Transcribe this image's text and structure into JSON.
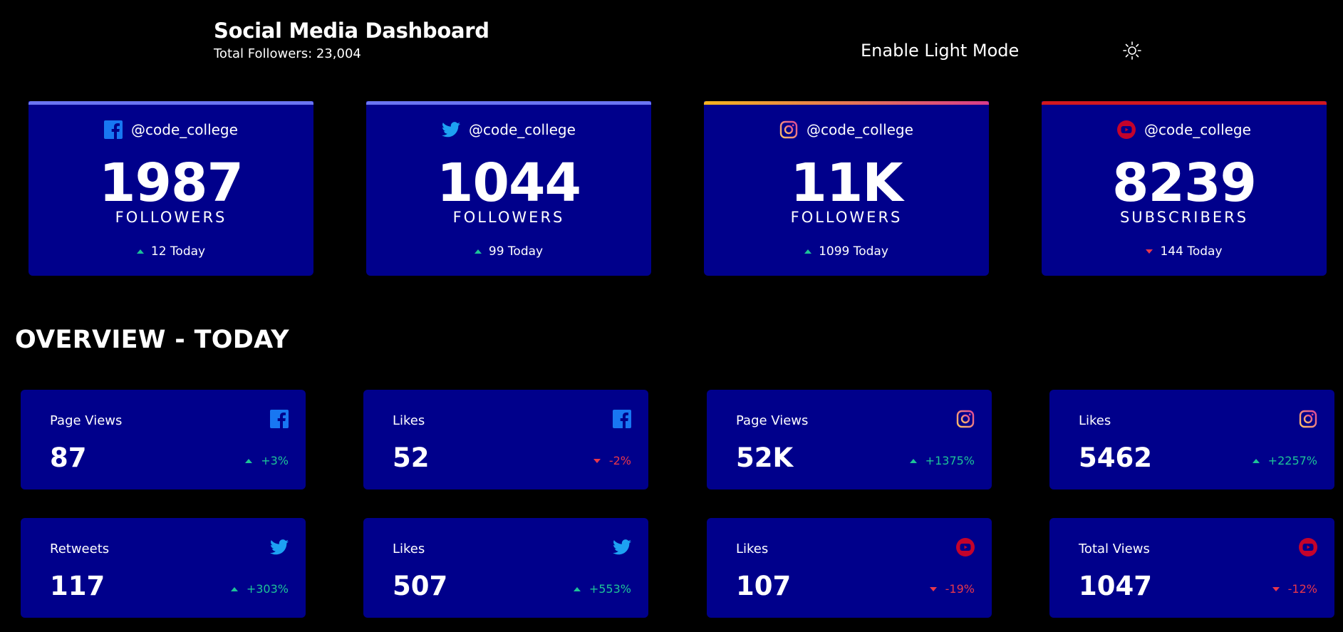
{
  "header": {
    "title": "Social Media Dashboard",
    "total_followers": "Total Followers: 23,004",
    "toggle_label": "Enable Light Mode",
    "toggle_icon": "sun-icon"
  },
  "colors": {
    "background": "#000000",
    "card": "#00008b",
    "facebook": "#6a75f3",
    "twitter": "#6a75f3",
    "instagram_start": "#f4b41f",
    "instagram_end": "#d83c8b",
    "youtube": "#d3181f",
    "up": "#1dc297",
    "down": "#e8374b"
  },
  "cards": [
    {
      "network": "facebook",
      "icon": "facebook-icon",
      "handle": "@code_college",
      "count": "1987",
      "label": "FOLLOWERS",
      "today": "12 Today",
      "trend": "up"
    },
    {
      "network": "twitter",
      "icon": "twitter-icon",
      "handle": "@code_college",
      "count": "1044",
      "label": "FOLLOWERS",
      "today": "99 Today",
      "trend": "up"
    },
    {
      "network": "instagram",
      "icon": "instagram-icon",
      "handle": "@code_college",
      "count": "11K",
      "label": "FOLLOWERS",
      "today": "1099 Today",
      "trend": "up"
    },
    {
      "network": "youtube",
      "icon": "youtube-icon",
      "handle": "@code_college",
      "count": "8239",
      "label": "SUBSCRIBERS",
      "today": "144 Today",
      "trend": "down"
    }
  ],
  "overview": {
    "title": "OVERVIEW - TODAY",
    "items": [
      {
        "metric": "Page Views",
        "value": "87",
        "change": "+3%",
        "trend": "up",
        "icon": "facebook-icon"
      },
      {
        "metric": "Likes",
        "value": "52",
        "change": "-2%",
        "trend": "down",
        "icon": "facebook-icon"
      },
      {
        "metric": "Page Views",
        "value": "52K",
        "change": "+1375%",
        "trend": "up",
        "icon": "instagram-icon"
      },
      {
        "metric": "Likes",
        "value": "5462",
        "change": "+2257%",
        "trend": "up",
        "icon": "instagram-icon"
      },
      {
        "metric": "Retweets",
        "value": "117",
        "change": "+303%",
        "trend": "up",
        "icon": "twitter-icon"
      },
      {
        "metric": "Likes",
        "value": "507",
        "change": "+553%",
        "trend": "up",
        "icon": "twitter-icon"
      },
      {
        "metric": "Likes",
        "value": "107",
        "change": "-19%",
        "trend": "down",
        "icon": "youtube-icon"
      },
      {
        "metric": "Total Views",
        "value": "1047",
        "change": "-12%",
        "trend": "down",
        "icon": "youtube-icon"
      }
    ]
  }
}
